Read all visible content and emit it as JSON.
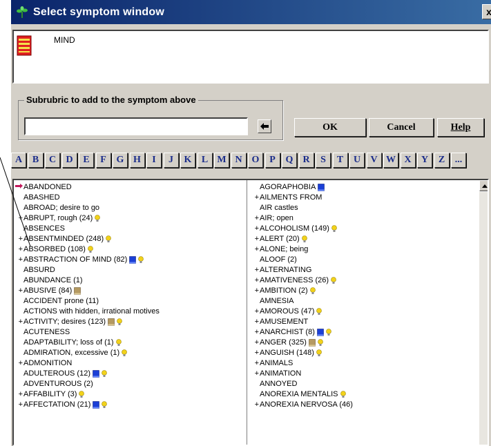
{
  "window": {
    "title": "Select symptom window",
    "close": "x"
  },
  "symptom": {
    "text": "MIND"
  },
  "subrubric": {
    "legend": "Subrubric to add to the symptom above",
    "value": ""
  },
  "buttons": {
    "ok": "OK",
    "cancel": "Cancel",
    "help": "Help"
  },
  "alphabet": [
    "A",
    "B",
    "C",
    "D",
    "E",
    "F",
    "G",
    "H",
    "I",
    "J",
    "K",
    "L",
    "M",
    "N",
    "O",
    "P",
    "Q",
    "R",
    "S",
    "T",
    "U",
    "V",
    "W",
    "X",
    "Y",
    "Z",
    "..."
  ],
  "left_items": [
    {
      "prefix": "",
      "text": "ABANDONED",
      "icons": []
    },
    {
      "prefix": "",
      "text": "ABASHED",
      "icons": []
    },
    {
      "prefix": "",
      "text": "ABROAD; desire to go",
      "icons": []
    },
    {
      "prefix": "+",
      "text": "ABRUPT, rough (24)",
      "icons": [
        "bulb"
      ]
    },
    {
      "prefix": "",
      "text": "ABSENCES",
      "icons": []
    },
    {
      "prefix": "+",
      "text": "ABSENTMINDED (248)",
      "icons": [
        "bulb"
      ]
    },
    {
      "prefix": "+",
      "text": "ABSORBED (108)",
      "icons": [
        "bulb"
      ]
    },
    {
      "prefix": "+",
      "text": "ABSTRACTION OF MIND (82)",
      "icons": [
        "blue-book",
        "bulb"
      ]
    },
    {
      "prefix": "",
      "text": "ABSURD",
      "icons": []
    },
    {
      "prefix": "",
      "text": "ABUNDANCE (1)",
      "icons": []
    },
    {
      "prefix": "+",
      "text": "ABUSIVE (84)",
      "icons": [
        "tan-book"
      ]
    },
    {
      "prefix": "",
      "text": "ACCIDENT prone (11)",
      "icons": []
    },
    {
      "prefix": "",
      "text": "ACTIONS with hidden, irrational motives",
      "icons": []
    },
    {
      "prefix": "+",
      "text": "ACTIVITY; desires (123)",
      "icons": [
        "tan-book",
        "bulb"
      ]
    },
    {
      "prefix": "",
      "text": "ACUTENESS",
      "icons": []
    },
    {
      "prefix": "",
      "text": "ADAPTABILITY; loss of (1)",
      "icons": [
        "bulb"
      ]
    },
    {
      "prefix": "",
      "text": "ADMIRATION, excessive (1)",
      "icons": [
        "bulb"
      ]
    },
    {
      "prefix": "+",
      "text": "ADMONITION",
      "icons": []
    },
    {
      "prefix": "",
      "text": "ADULTEROUS (12)",
      "icons": [
        "blue-book",
        "bulb"
      ]
    },
    {
      "prefix": "",
      "text": "ADVENTUROUS (2)",
      "icons": []
    },
    {
      "prefix": "+",
      "text": "AFFABILITY (3)",
      "icons": [
        "bulb"
      ]
    },
    {
      "prefix": "+",
      "text": "AFFECTATION (21)",
      "icons": [
        "blue-book",
        "bulb"
      ]
    }
  ],
  "right_items": [
    {
      "prefix": "",
      "text": "AGORAPHOBIA",
      "icons": [
        "blue-book"
      ]
    },
    {
      "prefix": "+",
      "text": "AILMENTS FROM",
      "icons": []
    },
    {
      "prefix": "",
      "text": "AIR castles",
      "icons": []
    },
    {
      "prefix": "+",
      "text": "AIR; open",
      "icons": []
    },
    {
      "prefix": "+",
      "text": "ALCOHOLISM (149)",
      "icons": [
        "bulb"
      ]
    },
    {
      "prefix": "+",
      "text": "ALERT (20)",
      "icons": [
        "bulb"
      ]
    },
    {
      "prefix": "+",
      "text": "ALONE; being",
      "icons": []
    },
    {
      "prefix": "",
      "text": "ALOOF (2)",
      "icons": []
    },
    {
      "prefix": "+",
      "text": "ALTERNATING",
      "icons": []
    },
    {
      "prefix": "+",
      "text": "AMATIVENESS (26)",
      "icons": [
        "bulb"
      ]
    },
    {
      "prefix": "+",
      "text": "AMBITION (2)",
      "icons": [
        "bulb"
      ]
    },
    {
      "prefix": "",
      "text": "AMNESIA",
      "icons": []
    },
    {
      "prefix": "+",
      "text": "AMOROUS (47)",
      "icons": [
        "bulb"
      ]
    },
    {
      "prefix": "+",
      "text": "AMUSEMENT",
      "icons": []
    },
    {
      "prefix": "+",
      "text": "ANARCHIST (8)",
      "icons": [
        "blue-book",
        "bulb"
      ]
    },
    {
      "prefix": "+",
      "text": "ANGER (325)",
      "icons": [
        "tan-book",
        "bulb"
      ]
    },
    {
      "prefix": "+",
      "text": "ANGUISH (148)",
      "icons": [
        "bulb"
      ]
    },
    {
      "prefix": "+",
      "text": "ANIMALS",
      "icons": []
    },
    {
      "prefix": "+",
      "text": "ANIMATION",
      "icons": []
    },
    {
      "prefix": "",
      "text": "ANNOYED",
      "icons": []
    },
    {
      "prefix": "",
      "text": "ANOREXIA MENTALIS",
      "icons": [
        "bulb"
      ]
    },
    {
      "prefix": "+",
      "text": "ANOREXIA NERVOSA (46)",
      "icons": []
    }
  ],
  "colors": {
    "title_start": "#0a246a",
    "title_end": "#3a6ea5",
    "letter_text": "#1a2c8a",
    "face": "#d4d0c8"
  }
}
